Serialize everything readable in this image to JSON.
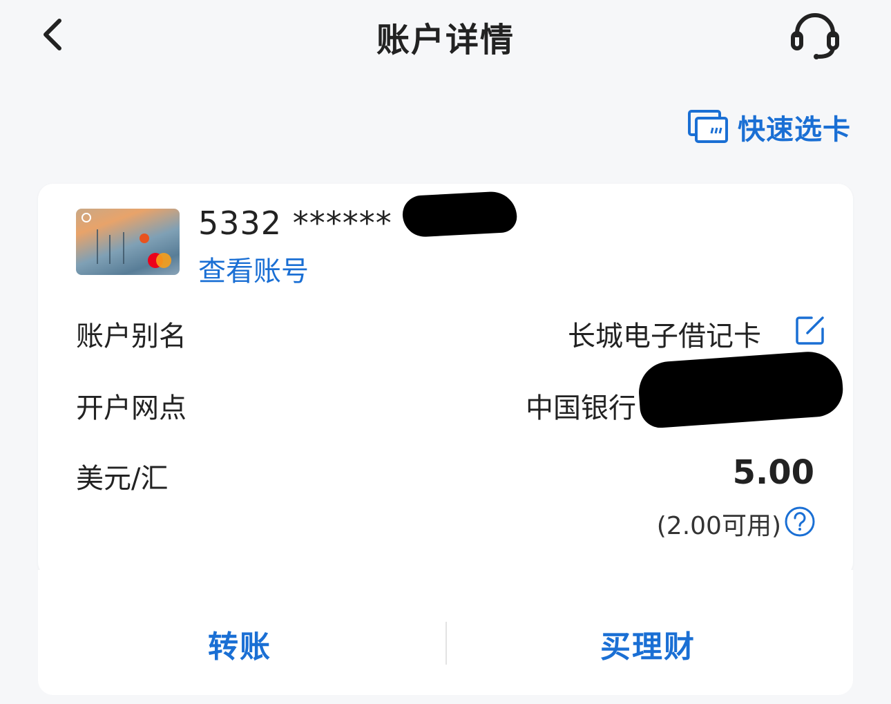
{
  "header": {
    "title": "账户详情"
  },
  "quick_select": {
    "label": "快速选卡"
  },
  "card": {
    "number_visible": "5332 ****** ",
    "view_account_label": "查看账号"
  },
  "rows": {
    "alias": {
      "label": "账户别名",
      "value": "长城电子借记卡"
    },
    "branch": {
      "label": "开户网点",
      "value": "中国银行"
    },
    "currency": {
      "label": "美元/汇",
      "balance": "5.00",
      "available": "(2.00可用)"
    }
  },
  "actions": {
    "transfer": "转账",
    "wealth": "买理财"
  },
  "colors": {
    "accent": "#1a6fd4",
    "background": "#f6f7f9",
    "text": "#222222"
  }
}
